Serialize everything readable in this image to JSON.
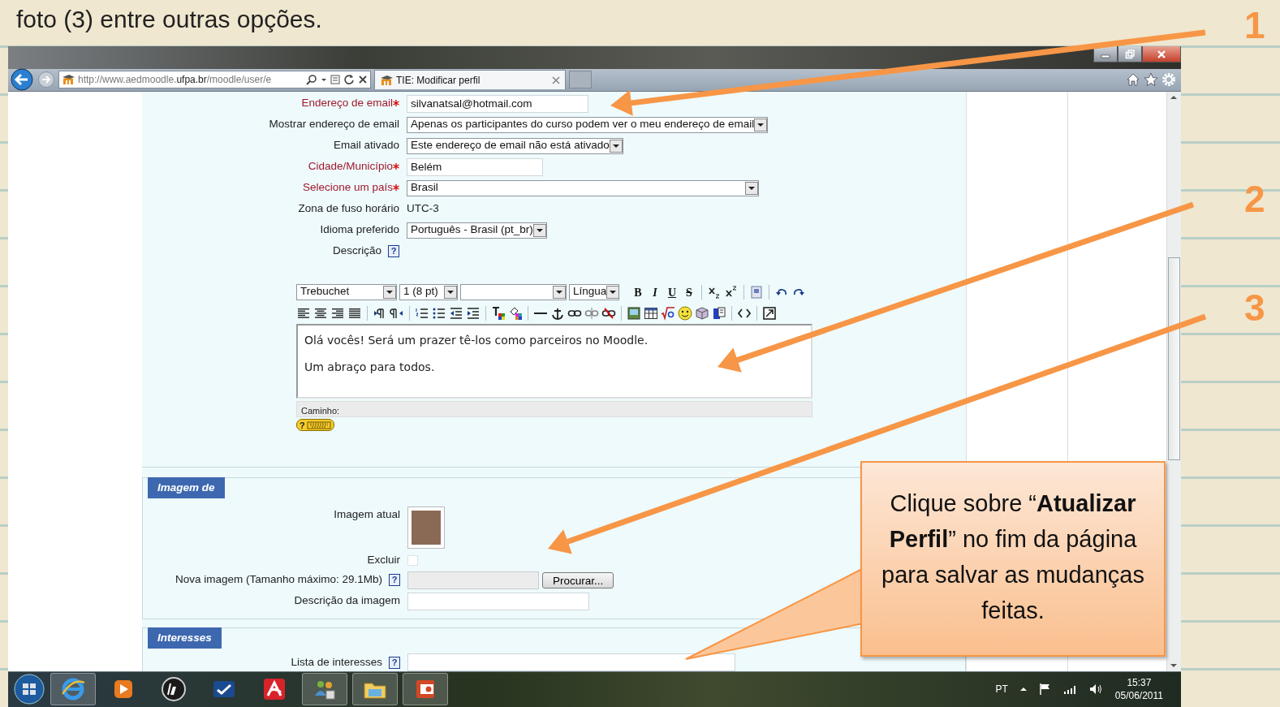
{
  "slide": {
    "heading": "foto (3) entre outras opções.",
    "step_numbers": [
      "1",
      "2",
      "3"
    ],
    "callout": "Clique sobre “**Atualizar Perfil**” no fim da página para salvar as mudanças feitas."
  },
  "browser": {
    "address": "http://www.aedmoodle.**ufpa.br**/moodle/user/e",
    "tabs": [
      {
        "label": "TIE: Modificar perfil",
        "selected": true
      }
    ]
  },
  "profile_fields": [
    {
      "kind": "text",
      "label": "Endereço de email",
      "required": true,
      "value": "silvanatsal@hotmail.com"
    },
    {
      "kind": "select",
      "label": "Mostrar endereço de email",
      "required": false,
      "value": "Apenas os participantes do curso podem ver o meu endereço de email"
    },
    {
      "kind": "select",
      "label": "Email ativado",
      "required": false,
      "value": "Este endereço de email não está ativado"
    },
    {
      "kind": "text",
      "label": "Cidade/Município",
      "required": true,
      "value": "Belém"
    },
    {
      "kind": "select",
      "label": "Selecione um país",
      "required": true,
      "value": "Brasil"
    },
    {
      "kind": "static",
      "label": "Zona de fuso horário",
      "required": false,
      "value": "UTC-3"
    },
    {
      "kind": "select",
      "label": "Idioma preferido",
      "required": false,
      "value": "Português - Brasil (pt_br)"
    },
    {
      "kind": "help",
      "label": "Descrição",
      "required": false,
      "value": "?"
    }
  ],
  "editor": {
    "font": "Trebuchet",
    "size": "1 (8 pt)",
    "language": "Língua",
    "format_buttons": [
      {
        "kind": "bold",
        "label": "B"
      },
      {
        "kind": "italic",
        "label": "I"
      },
      {
        "kind": "underline",
        "label": "U"
      },
      {
        "kind": "strike",
        "label": "S"
      }
    ],
    "paragraphs": [
      "Olá vocês! Será um prazer tê-los como parceiros no Moodle.",
      "Um abraço para todos."
    ],
    "path_label": "Caminho:",
    "keyboard_help": "?"
  },
  "image_section": {
    "legend": "Imagem de",
    "current_label": "Imagem atual",
    "delete_label": "Excluir",
    "delete_checked": false,
    "new_label": "Nova imagem (Tamanho máximo: 29.1Mb)",
    "new_help": "?",
    "browse_button": "Procurar...",
    "description_label": "Descrição da imagem"
  },
  "interests_section": {
    "legend": "Interesses",
    "list_label": "Lista de interesses",
    "list_help": "?"
  },
  "taskbar": {
    "language": "PT",
    "time": "15:37",
    "date": "05/06/2011"
  }
}
